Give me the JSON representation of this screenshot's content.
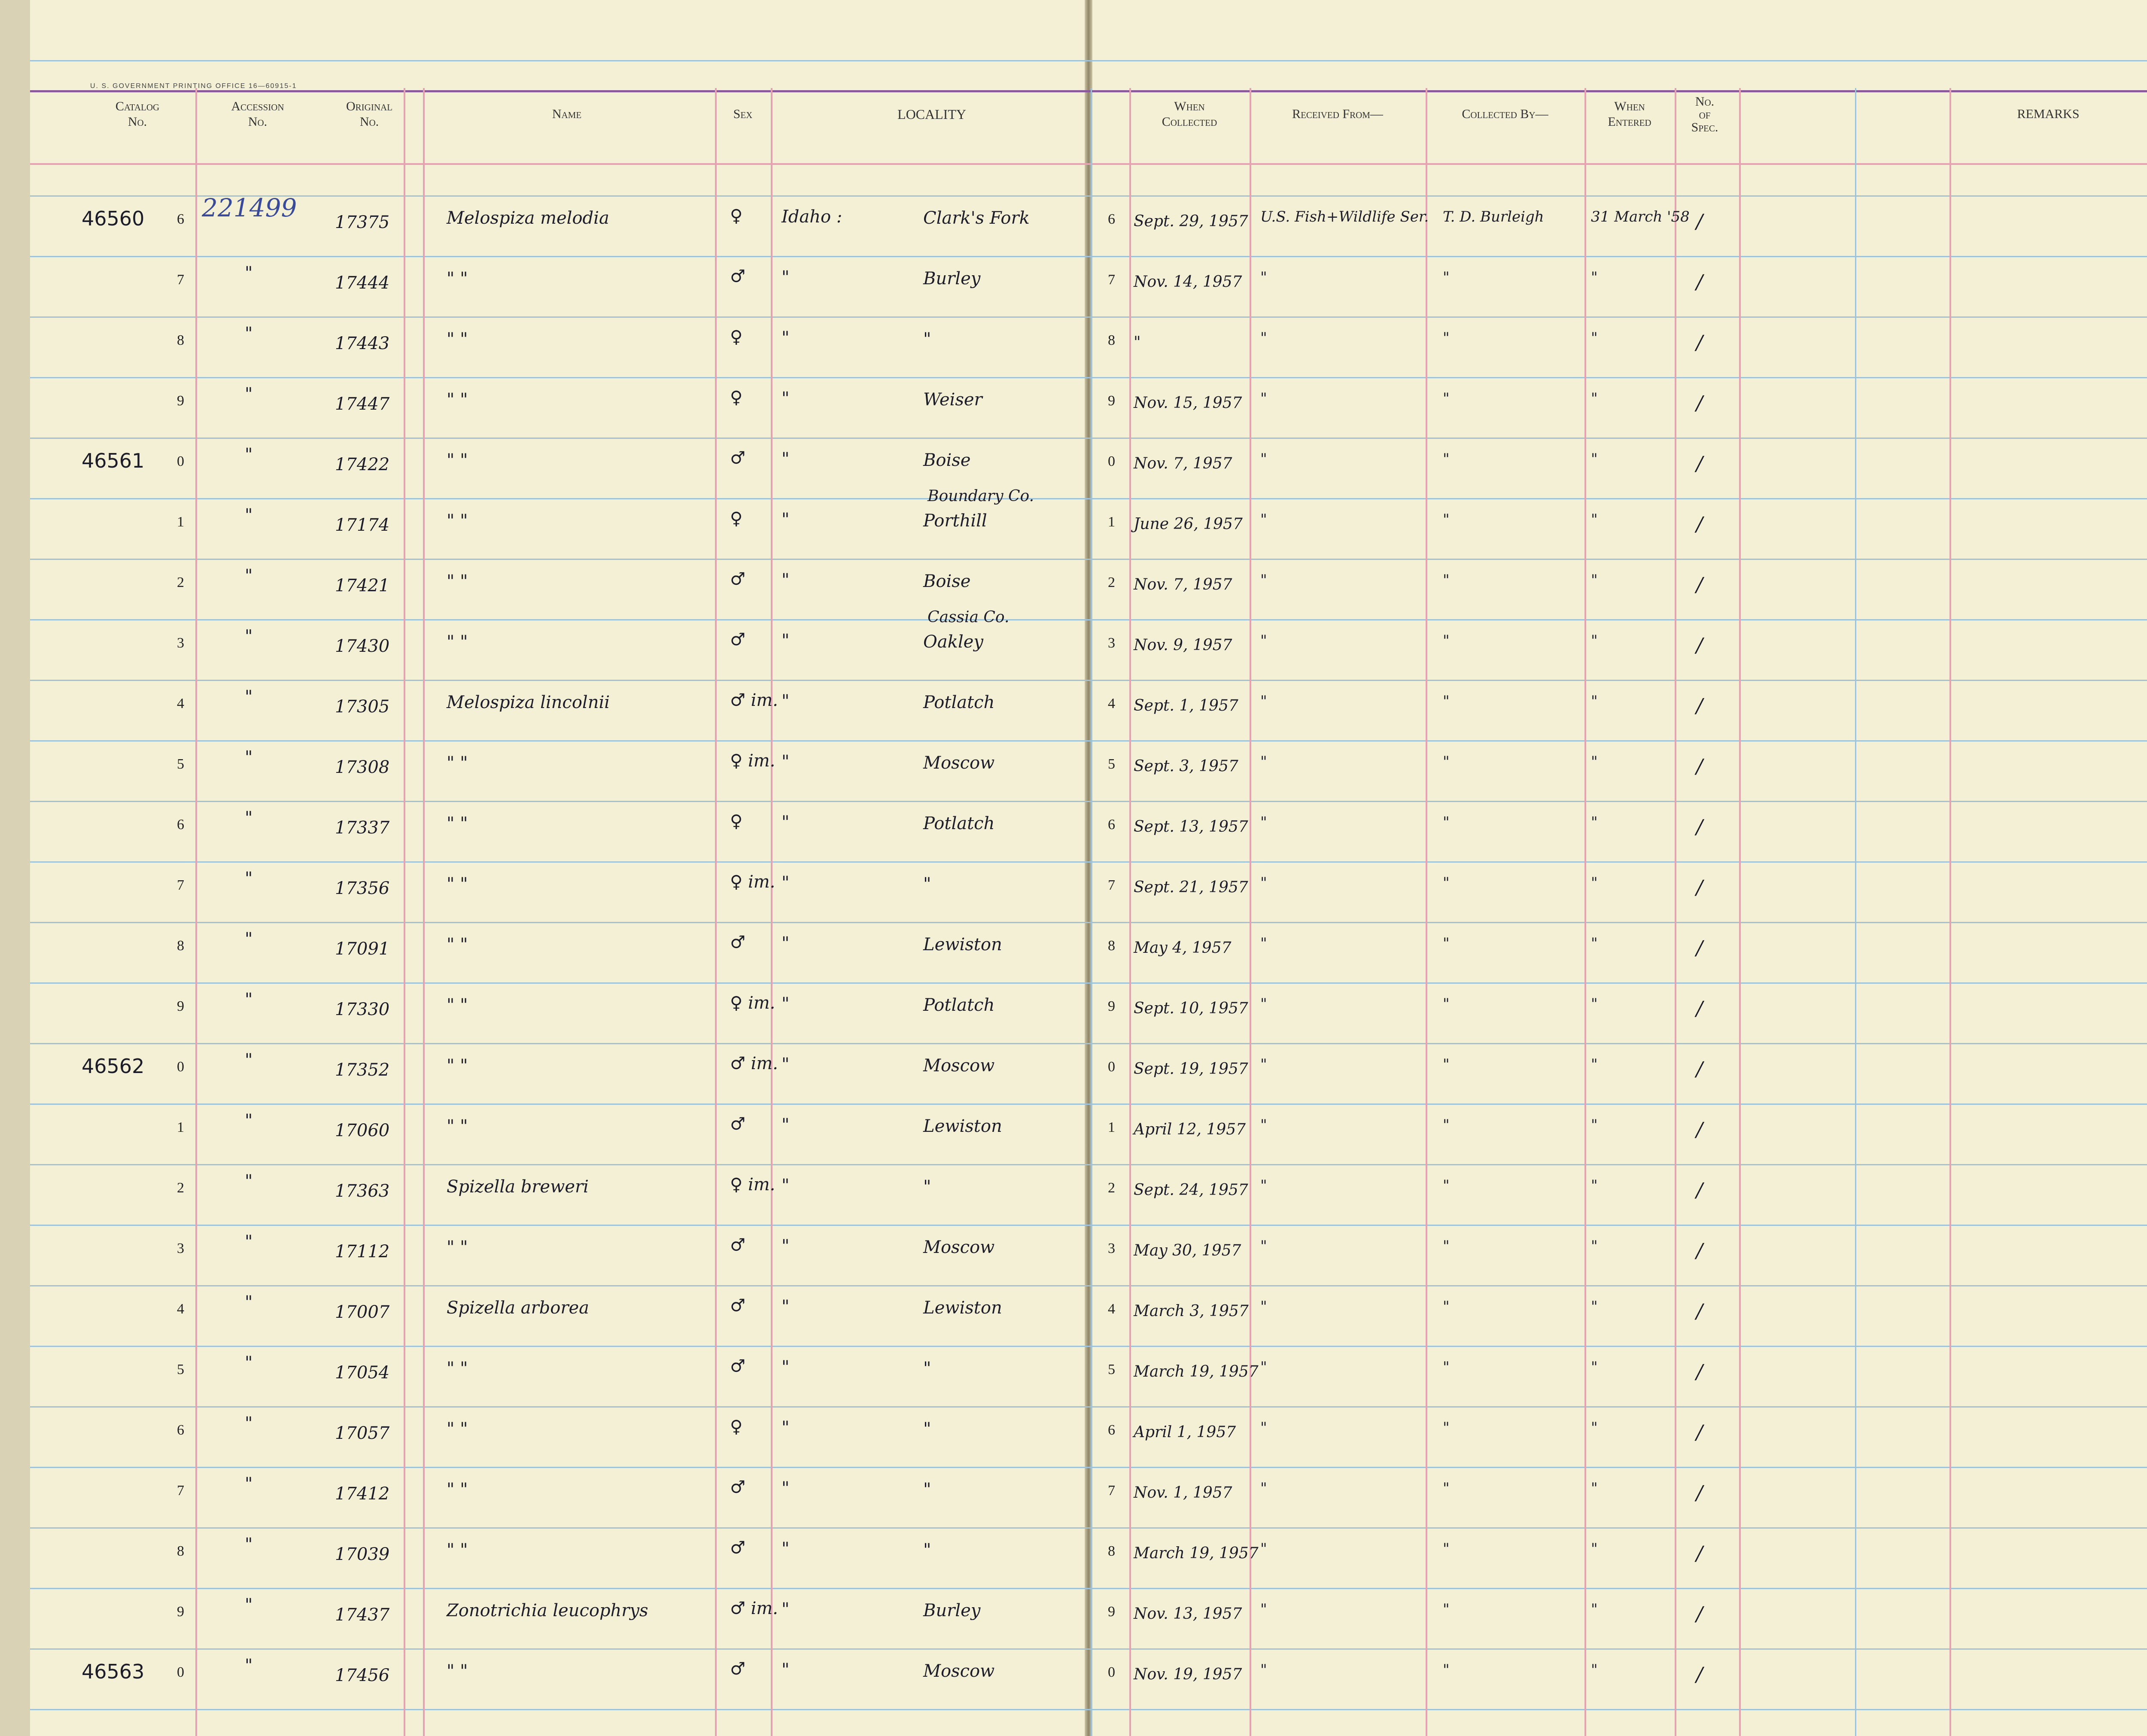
{
  "gpo_imprint": "U. S. GOVERNMENT PRINTING OFFICE    16—60915-1",
  "headers": {
    "catalog": [
      "Catalog",
      "No."
    ],
    "accession": [
      "Accession",
      "No."
    ],
    "original": [
      "Original",
      "No."
    ],
    "name": "Name",
    "sex": "Sex",
    "locality": "LOCALITY",
    "when_collected": [
      "When",
      "Collected"
    ],
    "received_from": "Received From—",
    "collected_by": "Collected By—",
    "when_entered": [
      "When",
      "Entered"
    ],
    "no_spec": [
      "No.",
      "of",
      "Spec."
    ],
    "remarks": "REMARKS"
  },
  "rows": [
    {
      "catalog": "46560",
      "digit": "6",
      "accession": "221499",
      "original": "17375",
      "name": "Melospiza   melodia",
      "sex": "♀",
      "locality_state": "Idaho :",
      "locality_county": "",
      "locality": "Clark's Fork",
      "date": "Sept. 29, 1957",
      "received": "U.S. Fish+Wildlife Ser.",
      "collector": "T. D. Burleigh",
      "entered": "31 March '58",
      "spec": "/"
    },
    {
      "catalog": "",
      "digit": "7",
      "accession": "\"",
      "original": "17444",
      "name": "\"        \"",
      "sex": "♂",
      "locality_state": "\"",
      "locality_county": "",
      "locality": "Burley",
      "date": "Nov. 14, 1957",
      "received": "\"",
      "collector": "\"",
      "entered": "\"",
      "spec": "/"
    },
    {
      "catalog": "",
      "digit": "8",
      "accession": "\"",
      "original": "17443",
      "name": "\"        \"",
      "sex": "♀",
      "locality_state": "\"",
      "locality_county": "",
      "locality": "\"",
      "date": "\"",
      "received": "\"",
      "collector": "\"",
      "entered": "\"",
      "spec": "/"
    },
    {
      "catalog": "",
      "digit": "9",
      "accession": "\"",
      "original": "17447",
      "name": "\"        \"",
      "sex": "♀",
      "locality_state": "\"",
      "locality_county": "",
      "locality": "Weiser",
      "date": "Nov. 15, 1957",
      "received": "\"",
      "collector": "\"",
      "entered": "\"",
      "spec": "/"
    },
    {
      "catalog": "46561",
      "digit": "0",
      "accession": "\"",
      "original": "17422",
      "name": "\"        \"",
      "sex": "♂",
      "locality_state": "\"",
      "locality_county": "",
      "locality": "Boise",
      "date": "Nov. 7, 1957",
      "received": "\"",
      "collector": "\"",
      "entered": "\"",
      "spec": "/"
    },
    {
      "catalog": "",
      "digit": "1",
      "accession": "\"",
      "original": "17174",
      "name": "\"        \"",
      "sex": "♀",
      "locality_state": "\"",
      "locality_county": "Boundary Co.",
      "locality": "Porthill",
      "date": "June 26, 1957",
      "received": "\"",
      "collector": "\"",
      "entered": "\"",
      "spec": "/"
    },
    {
      "catalog": "",
      "digit": "2",
      "accession": "\"",
      "original": "17421",
      "name": "\"        \"",
      "sex": "♂",
      "locality_state": "\"",
      "locality_county": "",
      "locality": "Boise",
      "date": "Nov. 7, 1957",
      "received": "\"",
      "collector": "\"",
      "entered": "\"",
      "spec": "/"
    },
    {
      "catalog": "",
      "digit": "3",
      "accession": "\"",
      "original": "17430",
      "name": "\"        \"",
      "sex": "♂",
      "locality_state": "\"",
      "locality_county": "Cassia Co.",
      "locality": "Oakley",
      "date": "Nov. 9, 1957",
      "received": "\"",
      "collector": "\"",
      "entered": "\"",
      "spec": "/"
    },
    {
      "catalog": "",
      "digit": "4",
      "accession": "\"",
      "original": "17305",
      "name": "Melospiza   lincolnii",
      "sex": "♂ im.",
      "locality_state": "\"",
      "locality_county": "",
      "locality": "Potlatch",
      "date": "Sept. 1, 1957",
      "received": "\"",
      "collector": "\"",
      "entered": "\"",
      "spec": "/"
    },
    {
      "catalog": "",
      "digit": "5",
      "accession": "\"",
      "original": "17308",
      "name": "\"        \"",
      "sex": "♀ im.",
      "locality_state": "\"",
      "locality_county": "",
      "locality": "Moscow",
      "date": "Sept. 3, 1957",
      "received": "\"",
      "collector": "\"",
      "entered": "\"",
      "spec": "/"
    },
    {
      "catalog": "",
      "digit": "6",
      "accession": "\"",
      "original": "17337",
      "name": "\"        \"",
      "sex": "♀",
      "locality_state": "\"",
      "locality_county": "",
      "locality": "Potlatch",
      "date": "Sept. 13, 1957",
      "received": "\"",
      "collector": "\"",
      "entered": "\"",
      "spec": "/"
    },
    {
      "catalog": "",
      "digit": "7",
      "accession": "\"",
      "original": "17356",
      "name": "\"        \"",
      "sex": "♀ im.",
      "locality_state": "\"",
      "locality_county": "",
      "locality": "\"",
      "date": "Sept. 21, 1957",
      "received": "\"",
      "collector": "\"",
      "entered": "\"",
      "spec": "/"
    },
    {
      "catalog": "",
      "digit": "8",
      "accession": "\"",
      "original": "17091",
      "name": "\"        \"",
      "sex": "♂",
      "locality_state": "\"",
      "locality_county": "",
      "locality": "Lewiston",
      "date": "May 4, 1957",
      "received": "\"",
      "collector": "\"",
      "entered": "\"",
      "spec": "/"
    },
    {
      "catalog": "",
      "digit": "9",
      "accession": "\"",
      "original": "17330",
      "name": "\"        \"",
      "sex": "♀ im.",
      "locality_state": "\"",
      "locality_county": "",
      "locality": "Potlatch",
      "date": "Sept. 10, 1957",
      "received": "\"",
      "collector": "\"",
      "entered": "\"",
      "spec": "/"
    },
    {
      "catalog": "46562",
      "digit": "0",
      "accession": "\"",
      "original": "17352",
      "name": "\"        \"",
      "sex": "♂ im.",
      "locality_state": "\"",
      "locality_county": "",
      "locality": "Moscow",
      "date": "Sept. 19, 1957",
      "received": "\"",
      "collector": "\"",
      "entered": "\"",
      "spec": "/"
    },
    {
      "catalog": "",
      "digit": "1",
      "accession": "\"",
      "original": "17060",
      "name": "\"        \"",
      "sex": "♂",
      "locality_state": "\"",
      "locality_county": "",
      "locality": "Lewiston",
      "date": "April 12, 1957",
      "received": "\"",
      "collector": "\"",
      "entered": "\"",
      "spec": "/"
    },
    {
      "catalog": "",
      "digit": "2",
      "accession": "\"",
      "original": "17363",
      "name": "Spizella   breweri",
      "sex": "♀ im.",
      "locality_state": "\"",
      "locality_county": "",
      "locality": "\"",
      "date": "Sept. 24, 1957",
      "received": "\"",
      "collector": "\"",
      "entered": "\"",
      "spec": "/"
    },
    {
      "catalog": "",
      "digit": "3",
      "accession": "\"",
      "original": "17112",
      "name": "\"        \"",
      "sex": "♂",
      "locality_state": "\"",
      "locality_county": "",
      "locality": "Moscow",
      "date": "May 30, 1957",
      "received": "\"",
      "collector": "\"",
      "entered": "\"",
      "spec": "/"
    },
    {
      "catalog": "",
      "digit": "4",
      "accession": "\"",
      "original": "17007",
      "name": "Spizella   arborea",
      "sex": "♂",
      "locality_state": "\"",
      "locality_county": "",
      "locality": "Lewiston",
      "date": "March 3, 1957",
      "received": "\"",
      "collector": "\"",
      "entered": "\"",
      "spec": "/"
    },
    {
      "catalog": "",
      "digit": "5",
      "accession": "\"",
      "original": "17054",
      "name": "\"        \"",
      "sex": "♂",
      "locality_state": "\"",
      "locality_county": "",
      "locality": "\"",
      "date": "March 19, 1957",
      "received": "\"",
      "collector": "\"",
      "entered": "\"",
      "spec": "/"
    },
    {
      "catalog": "",
      "digit": "6",
      "accession": "\"",
      "original": "17057",
      "name": "\"        \"",
      "sex": "♀",
      "locality_state": "\"",
      "locality_county": "",
      "locality": "\"",
      "date": "April 1, 1957",
      "received": "\"",
      "collector": "\"",
      "entered": "\"",
      "spec": "/"
    },
    {
      "catalog": "",
      "digit": "7",
      "accession": "\"",
      "original": "17412",
      "name": "\"        \"",
      "sex": "♂",
      "locality_state": "\"",
      "locality_county": "",
      "locality": "\"",
      "date": "Nov. 1, 1957",
      "received": "\"",
      "collector": "\"",
      "entered": "\"",
      "spec": "/"
    },
    {
      "catalog": "",
      "digit": "8",
      "accession": "\"",
      "original": "17039",
      "name": "\"        \"",
      "sex": "♂",
      "locality_state": "\"",
      "locality_county": "",
      "locality": "\"",
      "date": "March 19, 1957",
      "received": "\"",
      "collector": "\"",
      "entered": "\"",
      "spec": "/"
    },
    {
      "catalog": "",
      "digit": "9",
      "accession": "\"",
      "original": "17437",
      "name": "Zonotrichia   leucophrys",
      "sex": "♂ im.",
      "locality_state": "\"",
      "locality_county": "",
      "locality": "Burley",
      "date": "Nov. 13, 1957",
      "received": "\"",
      "collector": "\"",
      "entered": "\"",
      "spec": "/"
    },
    {
      "catalog": "46563",
      "digit": "0",
      "accession": "\"",
      "original": "17456",
      "name": "\"        \"",
      "sex": "♂",
      "locality_state": "\"",
      "locality_county": "",
      "locality": "Moscow",
      "date": "Nov. 19, 1957",
      "received": "\"",
      "collector": "\"",
      "entered": "\"",
      "spec": "/"
    }
  ]
}
